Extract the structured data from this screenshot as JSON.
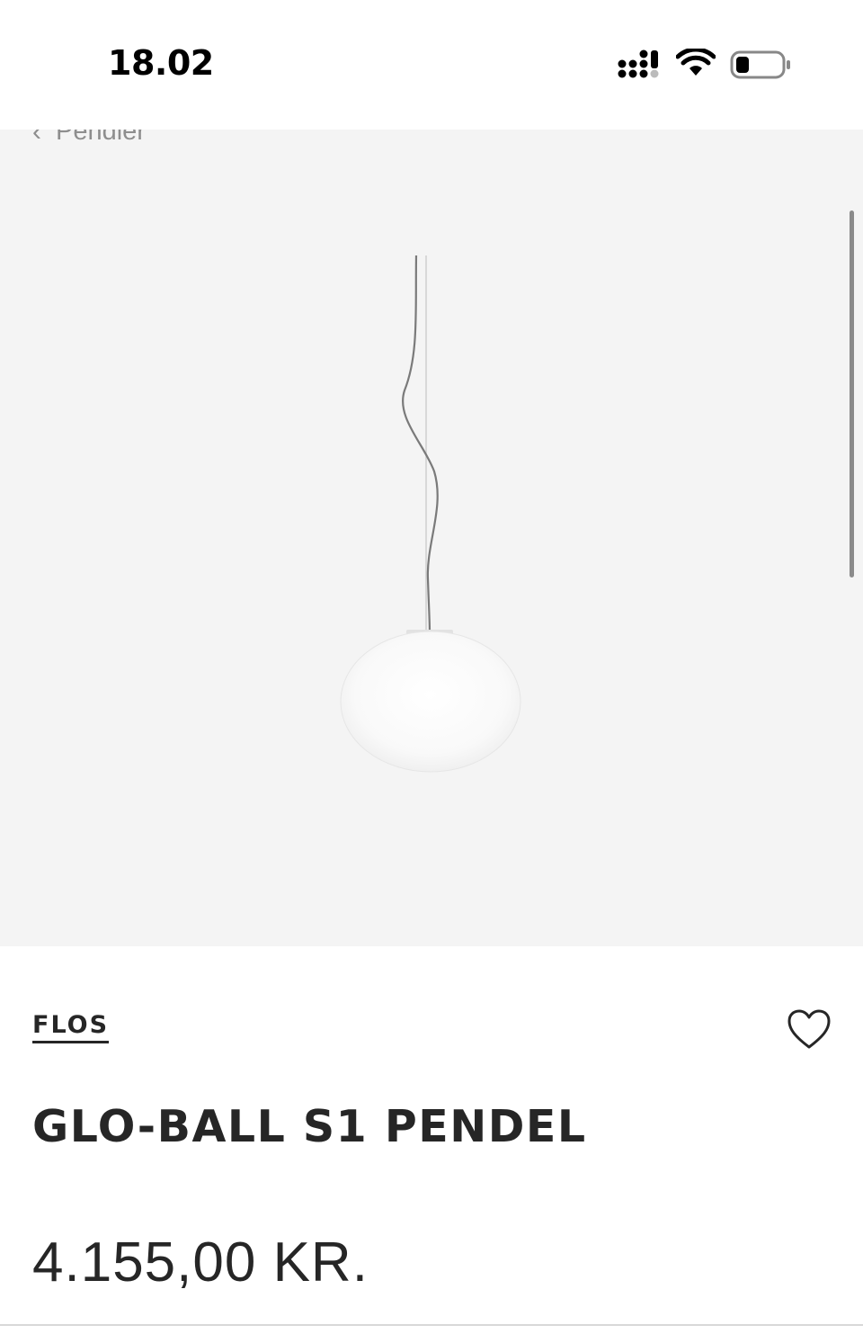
{
  "status_bar": {
    "time": "18.02",
    "icons": [
      "cellular-signal-icon",
      "wifi-icon",
      "battery-icon"
    ]
  },
  "breadcrumb": {
    "back_label": "Pendler",
    "icon": "chevron-left-icon"
  },
  "product": {
    "brand": "FLOS",
    "name": "GLO-BALL S1 PENDEL",
    "price": "4.155,00 KR.",
    "favorite_icon": "heart-outline-icon"
  },
  "colors": {
    "text": "#262626",
    "gallery_background": "#f4f4f4",
    "muted": "#8e8e8e"
  }
}
